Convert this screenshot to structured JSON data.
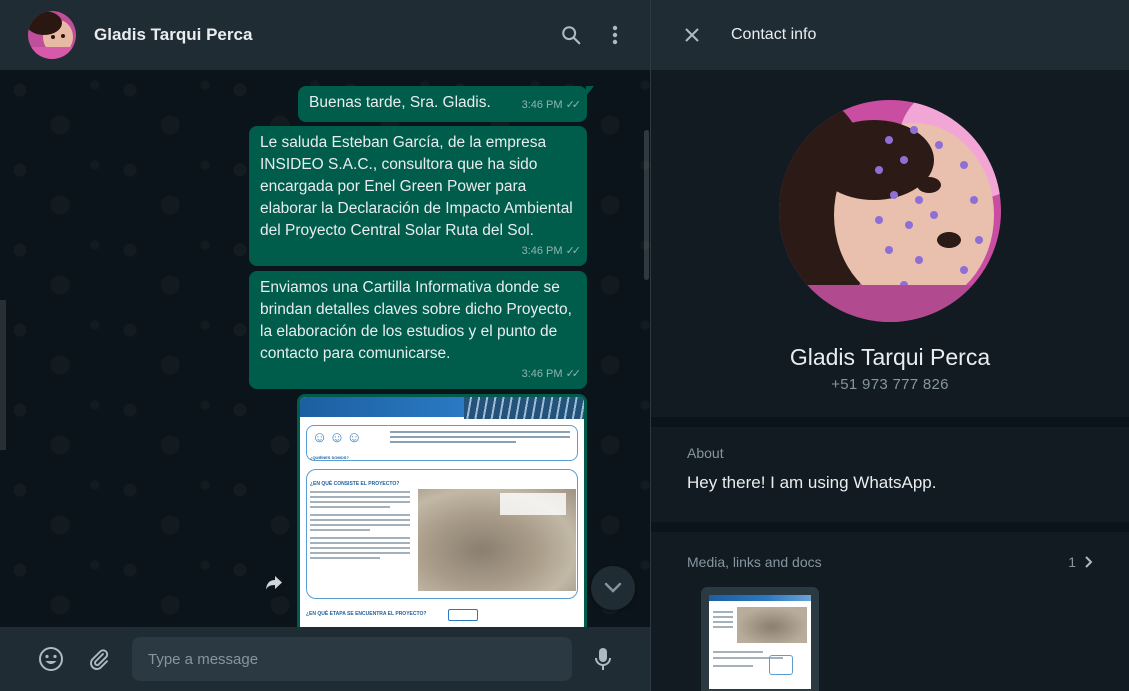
{
  "colors": {
    "outgoing_bubble": "#005c4b",
    "header_bg": "#202c33",
    "panel_bg": "#111b21",
    "app_bg": "#0b141a",
    "primary_text": "#e9edef",
    "secondary_text": "#8696a0"
  },
  "chat": {
    "contact_name": "Gladis Tarqui Perca",
    "header_icons": [
      "search-icon",
      "menu-icon"
    ],
    "messages": [
      {
        "text": "Buenas tarde, Sra. Gladis.",
        "time": "3:46 PM"
      },
      {
        "text": "Le saluda Esteban García, de la empresa INSIDEO S.A.C., consultora que ha sido encargada por Enel Green Power para elaborar la Declaración de Impacto Ambiental del Proyecto Central Solar Ruta del Sol.",
        "time": "3:46 PM"
      },
      {
        "text": "Enviamos una Cartilla Informativa donde se brindan detalles claves sobre dicho Proyecto, la elaboración de los estudios y el punto de contacto para comunicarse.",
        "time": "3:46 PM"
      }
    ],
    "image_message": {
      "section_1": "¿QUIÉNES SOMOS?",
      "section_2": "¿EN QUÉ CONSISTE EL PROYECTO?",
      "section_3": "¿EN QUÉ ETAPA SE ENCUENTRA EL PROYECTO?"
    },
    "footer": {
      "placeholder": "Type a message",
      "icons": [
        "emoji-icon",
        "attach-icon",
        "mic-icon"
      ]
    }
  },
  "contact_info": {
    "title": "Contact info",
    "name": "Gladis Tarqui Perca",
    "phone": "+51 973 777 826",
    "about_label": "About",
    "about_value": "Hey there! I am using WhatsApp.",
    "media_label": "Media, links and docs",
    "media_count": "1"
  }
}
